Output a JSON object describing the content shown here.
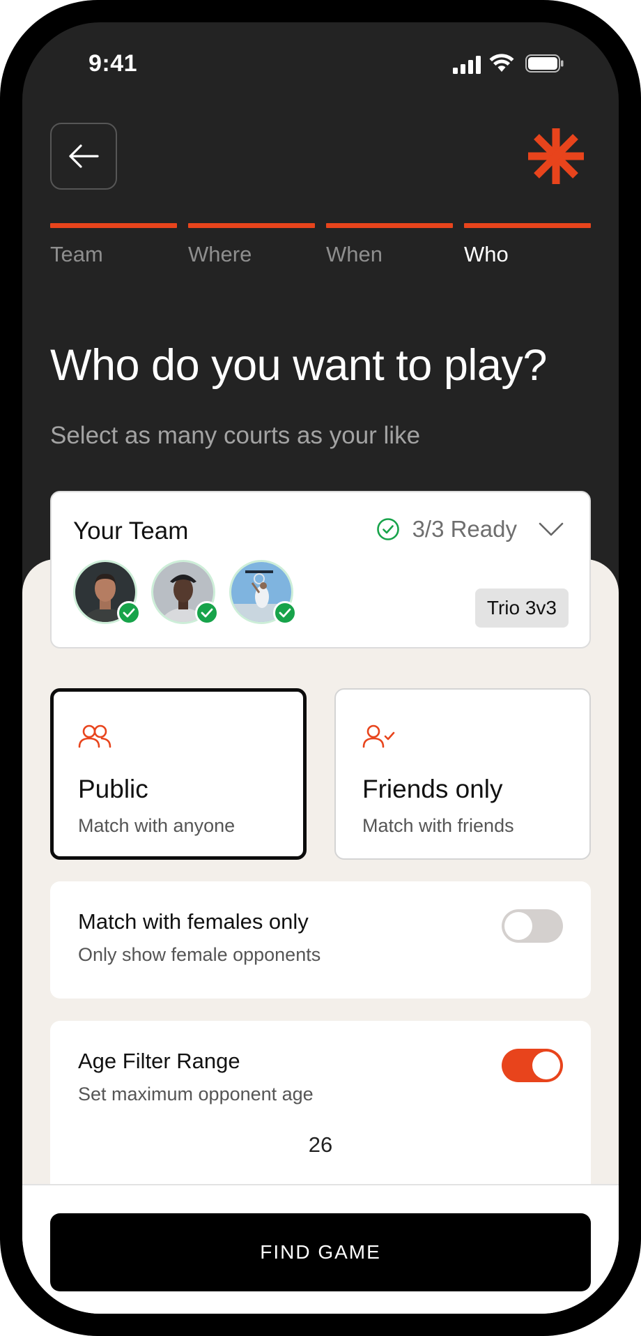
{
  "status_bar": {
    "time": "9:41"
  },
  "colors": {
    "accent": "#e8441c",
    "ready_green": "#17a34a",
    "dark_bg": "#232323",
    "content_bg": "#f3efea"
  },
  "header": {
    "back_icon": "arrow-left-icon",
    "logo_icon": "asterisk-logo-icon"
  },
  "steps": [
    {
      "label": "Team",
      "active": false
    },
    {
      "label": "Where",
      "active": false
    },
    {
      "label": "When",
      "active": false
    },
    {
      "label": "Who",
      "active": true
    }
  ],
  "page": {
    "title": "Who do you want to play?",
    "subtitle": "Select as many courts as your like"
  },
  "team": {
    "title": "Your Team",
    "ready_text": "3/3 Ready",
    "format_badge": "Trio 3v3",
    "members": [
      {
        "name": "member-1",
        "ready": true
      },
      {
        "name": "member-2",
        "ready": true
      },
      {
        "name": "member-3",
        "ready": true
      }
    ]
  },
  "match_type": [
    {
      "title": "Public",
      "subtitle": "Match with anyone",
      "icon": "users-icon",
      "selected": true
    },
    {
      "title": "Friends only",
      "subtitle": "Match with friends",
      "icon": "user-check-icon",
      "selected": false
    }
  ],
  "settings": {
    "female_only": {
      "title": "Match with females only",
      "subtitle": "Only show female opponents",
      "enabled": false
    },
    "age_filter": {
      "title": "Age Filter Range",
      "subtitle": "Set maximum opponent age",
      "enabled": true,
      "value": "26"
    }
  },
  "footer": {
    "button_label": "FIND GAME"
  }
}
